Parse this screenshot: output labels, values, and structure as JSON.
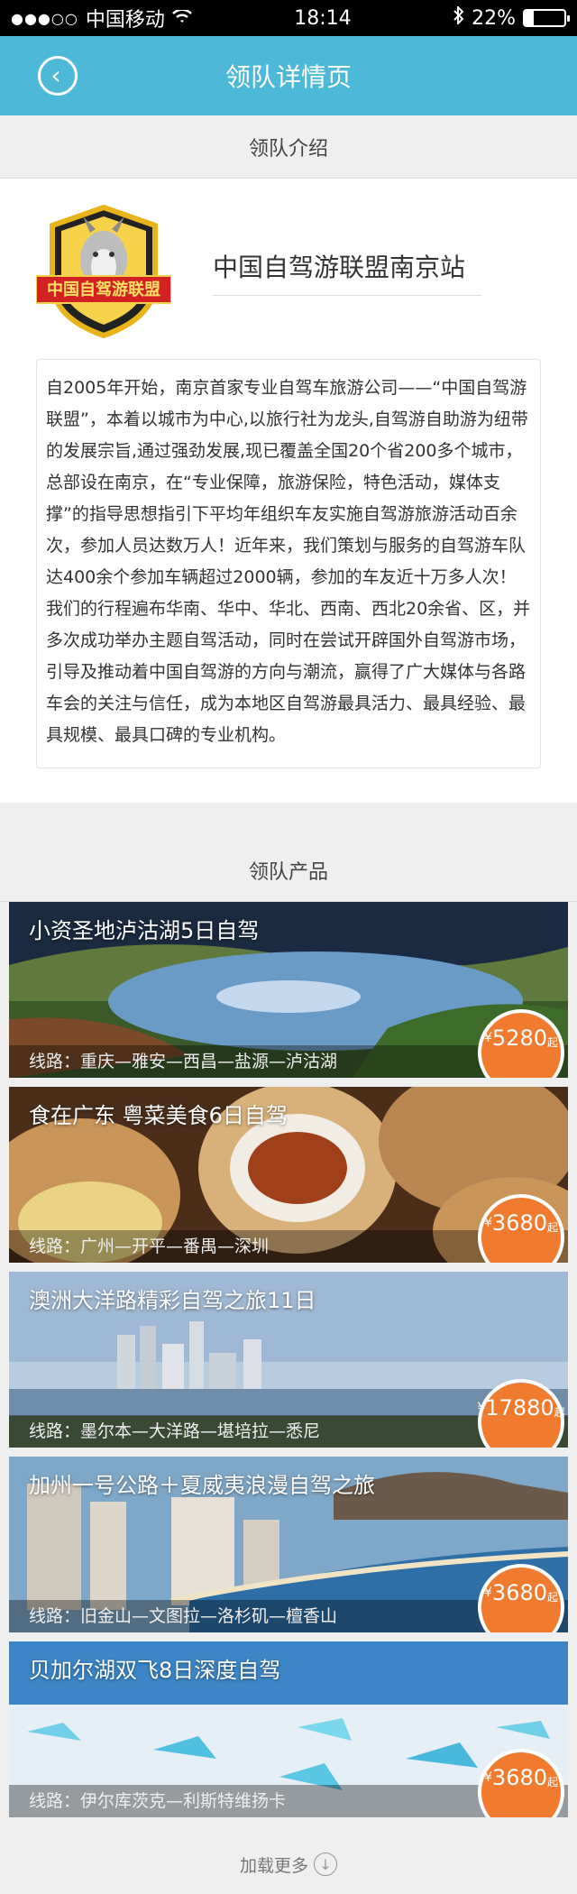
{
  "status": {
    "carrier": "中国移动",
    "time": "18:14",
    "battery_pct": 22,
    "battery_label": "22%",
    "bluetooth_icon": "bluetooth-icon",
    "wifi_icon": "wifi-icon"
  },
  "nav": {
    "title": "领队详情页",
    "back_icon": "back-arrow-icon"
  },
  "intro": {
    "section_title": "领队介绍",
    "logo_text": "中国自驾游联盟",
    "org_name": "中国自驾游联盟南京站",
    "description": "自2005年开始，南京首家专业自驾车旅游公司——“中国自驾游联盟”，本着以城市为中心,以旅行社为龙头,自驾游自助游为纽带的发展宗旨,通过强劲发展,现已覆盖全国20个省200多个城市，总部设在南京，在“专业保障，旅游保险，特色活动，媒体支撑”的指导思想指引下平均年组织车友实施自驾游旅游活动百余次，参加人员达数万人！近年来，我们策划与服务的自驾游车队达400余个参加车辆超过2000辆，参加的车友近十万多人次！ 我们的行程遍布华南、华中、华北、西南、西北20余省、区，并多次成功举办主题自驾活动，同时在尝试开辟国外自驾游市场，引导及推动着中国自驾游的方向与潮流，赢得了广大媒体与各路车会的关注与信任，成为本地区自驾游最具活力、最具经验、最具规模、最具口碑的专业机构。"
  },
  "products": {
    "section_title": "领队产品",
    "items": [
      {
        "title": "小资圣地泸沽湖5日自驾",
        "route": "线路：重庆—雅安—西昌—盐源—泸沽湖",
        "yen": "¥",
        "price": "5280",
        "suffix": "起"
      },
      {
        "title": "食在广东 粤菜美食6日自驾",
        "route": "线路：广州—开平—番禺—深圳",
        "yen": "¥",
        "price": "3680",
        "suffix": "起"
      },
      {
        "title": "澳洲大洋路精彩自驾之旅11日",
        "route": "线路：墨尔本—大洋路—堪培拉—悉尼",
        "yen": "¥",
        "price": "17880",
        "suffix": "起"
      },
      {
        "title": "加州一号公路＋夏威夷浪漫自驾之旅",
        "route": "线路：旧金山—文图拉—洛杉矶—檀香山",
        "yen": "¥",
        "price": "3680",
        "suffix": "起"
      },
      {
        "title": "贝加尔湖双飞8日深度自驾",
        "route": "线路：伊尔库茨克—利斯特维扬卡",
        "yen": "¥",
        "price": "3680",
        "suffix": "起"
      }
    ],
    "load_more": "加载更多",
    "load_more_icon": "down-arrow-circle-icon"
  }
}
